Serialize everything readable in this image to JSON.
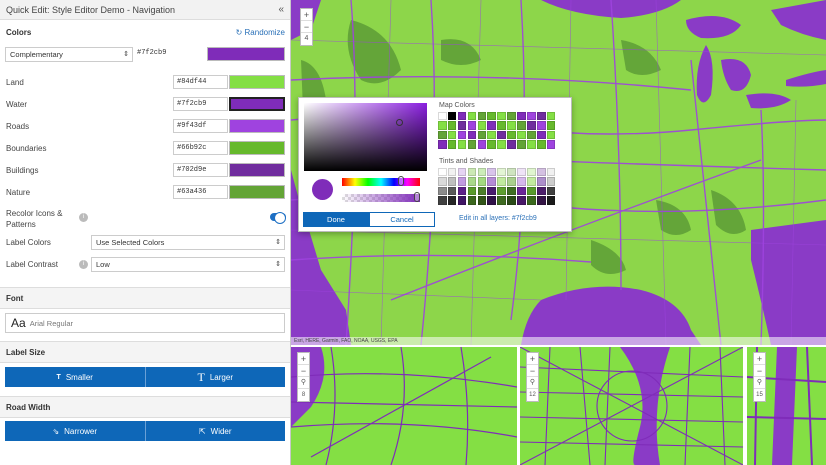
{
  "app": {
    "title": "Quick Edit: Style Editor Demo - Navigation",
    "collapse_icon": "double-chevron-left"
  },
  "colors_section": {
    "heading": "Colors",
    "randomize_label": "Randomize",
    "scheme": "Complementary",
    "scheme_hex": "#7f2cb9",
    "scheme_color": "#7f2cb9",
    "items": [
      {
        "label": "Land",
        "hex": "#84df44",
        "color": "#84df44"
      },
      {
        "label": "Water",
        "hex": "#7f2cb9",
        "color": "#7f2cb9",
        "selected": true
      },
      {
        "label": "Roads",
        "hex": "#9f43df",
        "color": "#9f43df"
      },
      {
        "label": "Boundaries",
        "hex": "#66b92c",
        "color": "#66b92c"
      },
      {
        "label": "Buildings",
        "hex": "#702d9e",
        "color": "#702d9e"
      },
      {
        "label": "Nature",
        "hex": "#63a436",
        "color": "#63a436"
      }
    ],
    "recolor_label_1": "Recolor Icons &",
    "recolor_label_2": "Patterns",
    "recolor_on": true,
    "label_colors_label": "Label Colors",
    "label_colors_value": "Use Selected Colors",
    "label_contrast_label": "Label Contrast",
    "label_contrast_value": "Low"
  },
  "font_section": {
    "heading": "Font",
    "sample": "Aa",
    "font_name": "Arial Regular"
  },
  "label_size_section": {
    "heading": "Label Size",
    "smaller": "Smaller",
    "larger": "Larger"
  },
  "road_width_section": {
    "heading": "Road Width",
    "narrower": "Narrower",
    "wider": "Wider"
  },
  "map": {
    "zoom_in": "+",
    "zoom_out": "−",
    "zoom_level": "4",
    "attribution": "Esri, HERE, Garmin, FAO, NOAA, USGS, EPA",
    "land_color": "#8dd64a",
    "water_color": "#8a3bc6",
    "mini_zoom_levels": [
      "8",
      "12",
      "15"
    ]
  },
  "picker": {
    "current_color": "#7f2cb9",
    "map_colors_title": "Map Colors",
    "tints_title": "Tints and Shades",
    "done_label": "Done",
    "cancel_label": "Cancel",
    "edit_all_label": "Edit in all layers: #7f2cb9",
    "map_colors": [
      "#ffffff",
      "#000000",
      "#7f2cb9",
      "#84df44",
      "#63a436",
      "#66b92c",
      "#84df44",
      "#63a436",
      "#7f2cb9",
      "#9f43df",
      "#702d9e",
      "#84df44",
      "#84df44",
      "#66b92c",
      "#702d9e",
      "#9f43df",
      "#84df44",
      "#7f2cb9",
      "#66b92c",
      "#84df44",
      "#63a436",
      "#702d9e",
      "#9f43df",
      "#66b92c",
      "#63a436",
      "#84df44",
      "#9f43df",
      "#7f2cb9",
      "#63a436",
      "#84df44",
      "#702d9e",
      "#66b92c",
      "#84df44",
      "#63a436",
      "#7f2cb9",
      "#84df44",
      "#7f2cb9",
      "#66b92c",
      "#84df44",
      "#63a436",
      "#9f43df",
      "#66b92c",
      "#84df44",
      "#702d9e",
      "#63a436",
      "#84df44",
      "#66b92c",
      "#9f43df"
    ],
    "tints": [
      "#ffffff",
      "#f2f2f2",
      "#e6d4f3",
      "#cce9b4",
      "#ccecb8",
      "#d9c4eb",
      "#e3f5d4",
      "#cfe4c0",
      "#efe3f7",
      "#e0f5cf",
      "#d4c0e2",
      "#f0f0f0",
      "#d9d9d9",
      "#bfbfbf",
      "#c29be0",
      "#a9d98a",
      "#a3d980",
      "#b58bd6",
      "#c1ea9f",
      "#a9cf8e",
      "#d6b8ec",
      "#c2eb9f",
      "#ad8ecb",
      "#cccccc",
      "#8c8c8c",
      "#595959",
      "#5e1f8a",
      "#5a9b2c",
      "#4c7f2a",
      "#4a1c6f",
      "#5e9f30",
      "#3f6e24",
      "#6b2599",
      "#589c2c",
      "#4d1e6b",
      "#404040",
      "#404040",
      "#262626",
      "#3f1563",
      "#3b671d",
      "#325418",
      "#2f1147",
      "#3e6a20",
      "#2a4a17",
      "#471866",
      "#3a681d",
      "#331445",
      "#1a1a1a"
    ]
  }
}
